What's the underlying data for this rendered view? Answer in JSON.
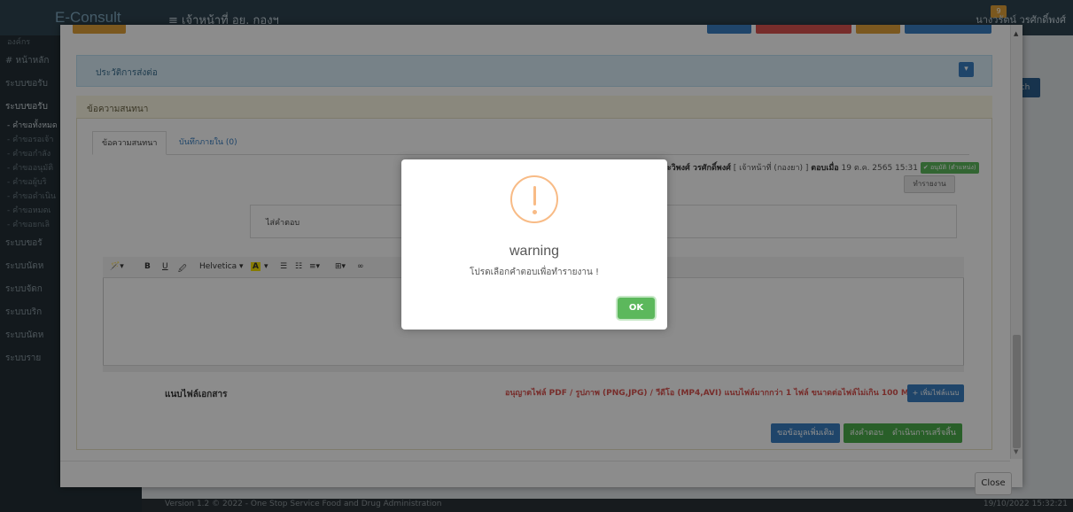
{
  "app": {
    "brand": "E-Consult",
    "header_menu": "≡  เจ้าหน้าที่ อย. กองฯ",
    "user": "นางวรัตน์ วรศักดิ์พงศ์",
    "notification_count": "9",
    "search_btn": "ch"
  },
  "sidebar": {
    "items": [
      {
        "label": "องค์กร"
      },
      {
        "label": "# หน้าหลัก"
      },
      {
        "label": "ระบบขอรับ"
      },
      {
        "label": "ระบบขอรับ"
      },
      {
        "label": "- คำขอทั้งหมด"
      },
      {
        "label": "- คำขอรอเจ้า"
      },
      {
        "label": "- คำขอกำลัง"
      },
      {
        "label": "- คำขออนุมัติ"
      },
      {
        "label": "- คำขอผู้บริ"
      },
      {
        "label": "- คำขอดำเนิน"
      },
      {
        "label": "- คำขอหมดเ"
      },
      {
        "label": "- คำขอยกเลิ"
      },
      {
        "label": "ระบบขอรั"
      },
      {
        "label": "ระบบนัดห"
      },
      {
        "label": "ระบบจัดก"
      },
      {
        "label": "ระบบบริก"
      },
      {
        "label": "ระบบนัดห"
      },
      {
        "label": "ระบบราย"
      }
    ]
  },
  "footer": {
    "version": "Version 1.2 © 2022 - One Stop Service Food and Drug Administration",
    "datetime": "19/10/2022 15:32:21"
  },
  "modal": {
    "panel_history_title": "ประวัติการส่งต่อ",
    "panel_chat_title": "ข้อความสนทนา",
    "tabs": [
      {
        "label": "ข้อความสนทนา"
      },
      {
        "label": "บันทึกภายใน (0)"
      }
    ],
    "message_meta": {
      "author": "ระวิพงศ์ วรศักดิ์พงศ์",
      "role": "[ เจ้าหน้าที่ (กองยา) ]",
      "answered_label": "ตอบเมื่อ",
      "answered_at": "19 ต.ค. 2565 15:31",
      "badge": "✔ อนุมัติ (ตำแหน่ง)"
    },
    "report_btn": "ทำรายงาน",
    "reply_label": "ไส่คำตอบ",
    "editor_toolbar": {
      "style": "🪄▾",
      "bold": "B",
      "underline": "U",
      "eraser": "🖉",
      "font": "Helvetica ▾",
      "color": "A",
      "color_caret": "▾",
      "ul": "☰",
      "ol": "☷",
      "align": "≡▾",
      "table": "⊞▾",
      "link": "∞"
    },
    "attach_label": "แนบไฟล์เอกสาร",
    "attach_note": "อนุญาตไฟล์ PDF / รูปภาพ (PNG,JPG) / วีดีโอ (MP4,AVI) แนบไฟล์มากกว่า 1 ไฟล์ ขนาดต่อไฟล์ไม่เกิน 100 MB",
    "attach_btn": "+ เพิ่มไฟล์แนบ",
    "action_buttons": [
      {
        "label": "ขอข้อมูลเพิ่มเติม"
      },
      {
        "label": "ส่งคำตอบ"
      },
      {
        "label": "ดำเนินการเสร็จสิ้น"
      }
    ],
    "close_btn": "Close"
  },
  "alert": {
    "title": "warning",
    "message": "โปรดเลือกคำตอบเพื่อทำรายงาน !",
    "ok": "OK",
    "icon_color": "#f8bb86",
    "ok_color": "#5cb85c"
  }
}
